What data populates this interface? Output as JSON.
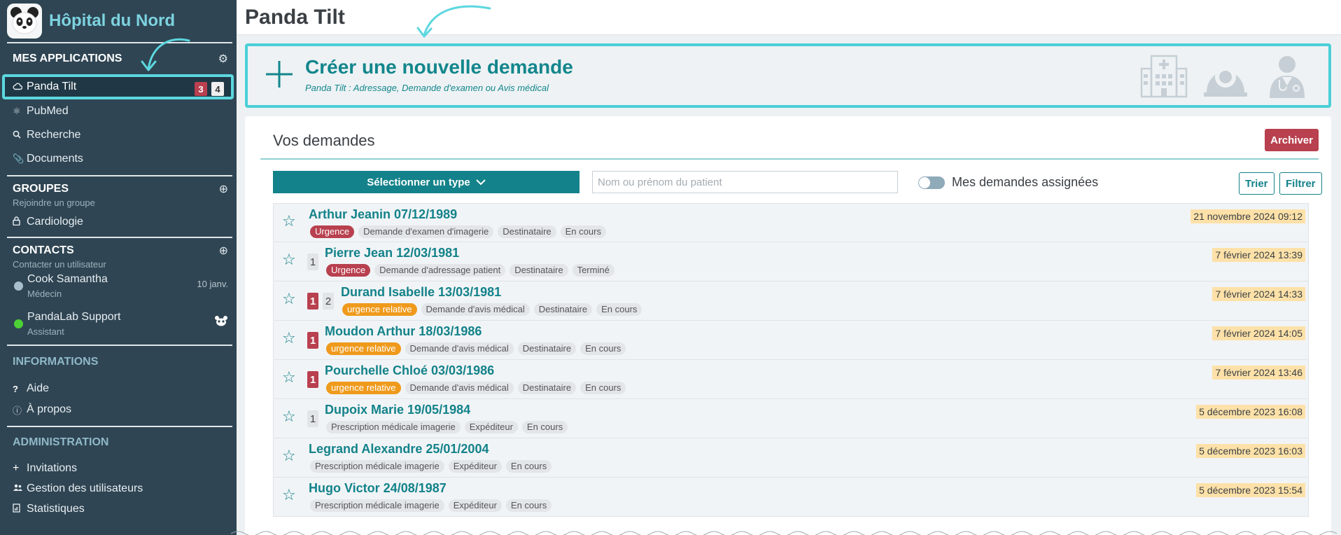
{
  "brand": {
    "name": "Hôpital du Nord",
    "logo_icon": "panda-logo"
  },
  "sidebar": {
    "apps_title": "MES APPLICATIONS",
    "apps": [
      {
        "label": "Panda Tilt",
        "icon": "cloud-icon",
        "badge_red": "3",
        "badge_white": "4"
      },
      {
        "label": "PubMed",
        "icon": "pubmed-icon"
      },
      {
        "label": "Recherche",
        "icon": "search-icon"
      },
      {
        "label": "Documents",
        "icon": "paperclip-icon"
      }
    ],
    "groups_title": "GROUPES",
    "groups_sub": "Rejoindre un groupe",
    "groups": [
      {
        "label": "Cardiologie",
        "icon": "lock-icon"
      }
    ],
    "contacts_title": "CONTACTS",
    "contacts_sub": "Contacter un utilisateur",
    "contacts": [
      {
        "name": "Cook Samantha",
        "role": "Médecin",
        "date": "10 janv.",
        "status": "#a8bfcc"
      },
      {
        "name": "PandaLab Support",
        "role": "Assistant",
        "status": "#4cd137"
      }
    ],
    "info_title": "INFORMATIONS",
    "info": [
      {
        "label": "Aide",
        "icon": "question-icon"
      },
      {
        "label": "À propos",
        "icon": "info-icon"
      }
    ],
    "admin_title": "ADMINISTRATION",
    "admin": [
      {
        "label": "Invitations",
        "icon": "plus-icon"
      },
      {
        "label": "Gestion des utilisateurs",
        "icon": "users-icon"
      },
      {
        "label": "Statistiques",
        "icon": "stats-icon"
      }
    ]
  },
  "header": {
    "title": "Panda Tilt"
  },
  "create": {
    "title": "Créer une nouvelle demande",
    "subtitle": "Panda Tilt : Adressage, Demande d'examen ou Avis médical"
  },
  "requests": {
    "title": "Vos demandes",
    "archive_label": "Archiver",
    "type_select_label": "Sélectionner un type",
    "search_placeholder": "Nom ou prénom du patient",
    "toggle_label": "Mes demandes assignées",
    "toggle_on": false,
    "sort_label": "Trier",
    "filter_label": "Filtrer",
    "rows": [
      {
        "name": "Arthur Jeanin 07/12/1989",
        "priority": "Urgence",
        "type": "Demande d'examen d'imagerie",
        "role": "Destinataire",
        "status": "En cours",
        "date": "21 novembre 2024 09:12"
      },
      {
        "name": "Pierre Jean 12/03/1981",
        "gray_count": "1",
        "priority": "Urgence",
        "type": "Demande d'adressage patient",
        "role": "Destinataire",
        "status": "Terminé",
        "date": "7 février 2024 13:39"
      },
      {
        "name": "Durand Isabelle 13/03/1981",
        "red_count": "1",
        "gray_count": "2",
        "priority": "urgence relative",
        "type": "Demande d'avis médical",
        "role": "Destinataire",
        "status": "En cours",
        "date": "7 février 2024 14:33"
      },
      {
        "name": "Moudon Arthur 18/03/1986",
        "red_count": "1",
        "priority": "urgence relative",
        "type": "Demande d'avis médical",
        "role": "Destinataire",
        "status": "En cours",
        "date": "7 février 2024 14:05"
      },
      {
        "name": "Pourchelle Chloé 03/03/1986",
        "red_count": "1",
        "priority": "urgence relative",
        "type": "Demande d'avis médical",
        "role": "Destinataire",
        "status": "En cours",
        "date": "7 février 2024 13:46"
      },
      {
        "name": "Dupoix Marie 19/05/1984",
        "gray_count": "1",
        "type": "Prescription médicale imagerie",
        "role": "Expéditeur",
        "status": "En cours",
        "date": "5 décembre 2023 16:08"
      },
      {
        "name": "Legrand Alexandre 25/01/2004",
        "type": "Prescription médicale imagerie",
        "role": "Expéditeur",
        "status": "En cours",
        "date": "5 décembre 2023 16:03"
      },
      {
        "name": "Hugo Victor 24/08/1987",
        "type": "Prescription médicale imagerie",
        "role": "Expéditeur",
        "status": "En cours",
        "date": "5 décembre 2023 15:54"
      }
    ]
  },
  "colors": {
    "accent": "#13828a",
    "highlight": "#4bcfd7",
    "danger": "#b8404f",
    "warning": "#ef9a1c",
    "sidebar": "#2f4553"
  }
}
